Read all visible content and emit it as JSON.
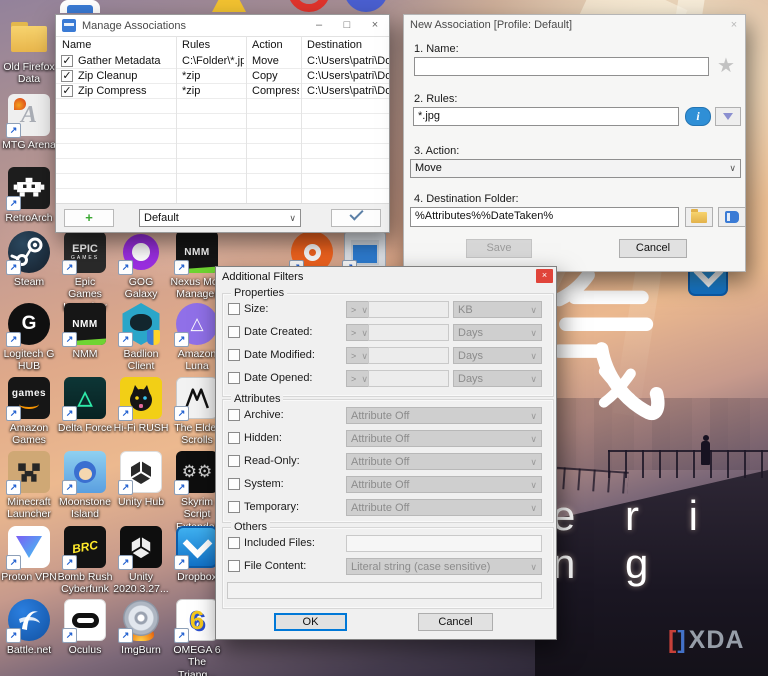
{
  "icon_glyphs": {
    "shortcut": "↗",
    "close": "×",
    "minimize": "–",
    "maximize": "□",
    "star": "★",
    "info": "i",
    "add": "+"
  },
  "wallpaper": {
    "kanji": "気",
    "title_fragment": "e r i n g",
    "watermark": {
      "bracket_left": "[",
      "bracket_right": "]",
      "text": "XDA"
    }
  },
  "desktop": {
    "icons": {
      "old_firefox_data": {
        "label": "Old Firefox Data"
      },
      "mtg_arena": {
        "label": "MTG Arena",
        "glyph": "A"
      },
      "retroarch": {
        "label": "RetroArch"
      },
      "steam": {
        "label": "Steam"
      },
      "epic_games_launcher": {
        "label": "Epic Games Launcher",
        "glyph1": "EPIC",
        "glyph2": "GAMES"
      },
      "gog_galaxy": {
        "label": "GOG Galaxy"
      },
      "nexus_mod_manager": {
        "label": "Nexus Mod Manager",
        "glyph": "NMM"
      },
      "logitech_g_hub": {
        "label": "Logitech G HUB",
        "glyph": "G"
      },
      "nmm": {
        "label": "NMM",
        "glyph": "NMM"
      },
      "badlion_client": {
        "label": "Badlion Client"
      },
      "amazon_luna": {
        "label": "Amazon Luna",
        "glyph": "△"
      },
      "amazon_games": {
        "label": "Amazon Games",
        "glyph": "games"
      },
      "delta_force": {
        "label": "Delta Force",
        "glyph": "△"
      },
      "hifi_rush": {
        "label": "Hi-Fi RUSH"
      },
      "the_elder_scrolls": {
        "label": "The Elder Scrolls"
      },
      "minecraft_launcher": {
        "label": "Minecraft Launcher"
      },
      "moonstone_island": {
        "label": "Moonstone Island"
      },
      "unity_hub": {
        "label": "Unity Hub"
      },
      "skyrim_script_extender": {
        "label": "Skyrim Script Extender",
        "glyph": "⚙⚙"
      },
      "proton_vpn": {
        "label": "Proton VPN"
      },
      "bomb_rush_cyberfunk": {
        "label": "Bomb Rush Cyberfunk",
        "glyph": "BRC"
      },
      "unity_2020": {
        "label": "Unity 2020.3.27..."
      },
      "dropbox": {
        "label": "Dropbox"
      },
      "battle_net": {
        "label": "Battle.net"
      },
      "oculus": {
        "label": "Oculus"
      },
      "imgburn": {
        "label": "ImgBurn"
      },
      "omega_6": {
        "label": "OMEGA 6 The Triang...",
        "glyph": "6"
      }
    }
  },
  "manage_associations": {
    "title": "Manage Associations",
    "columns": [
      "Name",
      "Rules",
      "Action",
      "Destination"
    ],
    "rows": [
      {
        "checked": "✓",
        "name": "Gather Metadata",
        "rules": "C:\\Folder\\*.jpg",
        "action": "Move",
        "destination": "C:\\Users\\patri\\Do..."
      },
      {
        "checked": "✓",
        "name": "Zip Cleanup",
        "rules": "*zip",
        "action": "Copy",
        "destination": "C:\\Users\\patri\\Do..."
      },
      {
        "checked": "✓",
        "name": "Zip Compress",
        "rules": "*zip",
        "action": "Compress",
        "destination": "C:\\Users\\patri\\Do..."
      }
    ],
    "profile_value": "Default"
  },
  "new_association": {
    "title": "New Association [Profile: Default]",
    "name_label": "1. Name:",
    "name_value": "",
    "rules_label": "2. Rules:",
    "rules_value": "*.jpg",
    "action_label": "3. Action:",
    "action_value": "Move",
    "destination_label": "4. Destination Folder:",
    "destination_value": "%Attributes%%DateTaken%",
    "save_label": "Save",
    "cancel_label": "Cancel"
  },
  "additional_filters": {
    "title": "Additional Filters",
    "properties": {
      "label": "Properties",
      "rows": [
        {
          "label": "Size:",
          "op": ">",
          "value": "",
          "unit": "KB"
        },
        {
          "label": "Date Created:",
          "op": ">",
          "value": "",
          "unit": "Days"
        },
        {
          "label": "Date Modified:",
          "op": ">",
          "value": "",
          "unit": "Days"
        },
        {
          "label": "Date Opened:",
          "op": ">",
          "value": "",
          "unit": "Days"
        }
      ]
    },
    "attributes": {
      "label": "Attributes",
      "rows": [
        {
          "label": "Archive:",
          "value": "Attribute Off"
        },
        {
          "label": "Hidden:",
          "value": "Attribute Off"
        },
        {
          "label": "Read-Only:",
          "value": "Attribute Off"
        },
        {
          "label": "System:",
          "value": "Attribute Off"
        },
        {
          "label": "Temporary:",
          "value": "Attribute Off"
        }
      ]
    },
    "others": {
      "label": "Others",
      "included_files_label": "Included Files:",
      "included_files_value": "",
      "file_content_label": "File Content:",
      "file_content_value": "Literal string (case sensitive)",
      "content_value": ""
    },
    "ok_label": "OK",
    "cancel_label": "Cancel"
  }
}
